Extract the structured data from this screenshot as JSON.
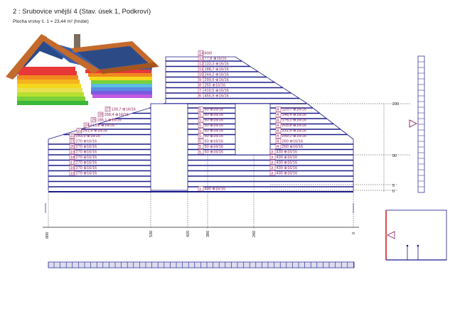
{
  "header": {
    "title": "2 : Srubovice vnější 4 (Stav. úsek 1, Podkroví)",
    "subtitle": "Plocha vrstvy č. 1 = 23,44 m² (hrubé)"
  },
  "colors": {
    "log_line": "#1a1a8c",
    "label_text": "#8a1a5a",
    "dimension_text": "#222222",
    "highlight_red": "#d23a3a"
  },
  "left_wall": {
    "labels": [
      {
        "n": "27",
        "t": "130,7 ⊕16/16"
      },
      {
        "n": "26",
        "t": "158,4 ⊕16/16"
      },
      {
        "n": "25",
        "t": "186,1 ⊕16/16"
      },
      {
        "n": "24",
        "t": "213,8 ⊕16/16"
      },
      {
        "n": "23",
        "t": "241,5 ⊕16/16"
      },
      {
        "n": "22",
        "t": "253,9 ⊕16/16"
      },
      {
        "n": "21",
        "t": "270 ⊕16/16"
      },
      {
        "n": "20",
        "t": "270 ⊕16/16"
      },
      {
        "n": "19",
        "t": "270 ⊕16/16"
      },
      {
        "n": "18",
        "t": "270 ⊕16/16"
      },
      {
        "n": "17",
        "t": "270 ⊕16/16"
      },
      {
        "n": "16",
        "t": "270 ⊕16/16"
      },
      {
        "n": "15",
        "t": "270 ⊕16/16"
      }
    ]
  },
  "center_upper": {
    "labels": [
      {
        "n": "14",
        "t": "60/0"
      },
      {
        "n": "13",
        "t": "77,8 ⊕16/16"
      },
      {
        "n": "12",
        "t": "133,3 ⊕16/16"
      },
      {
        "n": "11",
        "t": "188,7 ⊕16/16"
      },
      {
        "n": "10",
        "t": "244,2 ⊕16/16"
      },
      {
        "n": "9",
        "t": "299,6 ⊕16/16"
      },
      {
        "n": "8",
        "t": "355 ⊕16/16"
      },
      {
        "n": "7",
        "t": "410,5 ⊕16/16"
      },
      {
        "n": "6",
        "t": "465,9 ⊕16/16"
      }
    ]
  },
  "center_column": {
    "labels": [
      {
        "n": "5",
        "t": "50 ⊕16/16"
      },
      {
        "n": "5",
        "t": "50 ⊕16/16"
      },
      {
        "n": "5",
        "t": "50 ⊕16/16"
      },
      {
        "n": "5",
        "t": "50 ⊕16/16"
      },
      {
        "n": "5",
        "t": "50 ⊕16/16"
      },
      {
        "n": "5",
        "t": "50 ⊕16/16"
      },
      {
        "n": "5",
        "t": "50 ⊕16/16"
      },
      {
        "n": "5",
        "t": "50 ⊕16/16"
      },
      {
        "n": "5",
        "t": "50 ⊕16/16"
      }
    ],
    "bottom_label": {
      "n": "1",
      "t": "400 ⊕16/16"
    }
  },
  "right_wall": {
    "labels": [
      {
        "n": "4",
        "t": "120,7 ⊕16/16"
      },
      {
        "n": "4",
        "t": "148,4 ⊕16/16"
      },
      {
        "n": "4",
        "t": "176,1 ⊕16/16"
      },
      {
        "n": "4",
        "t": "203,8 ⊕16/16"
      },
      {
        "n": "4",
        "t": "231,5 ⊕16/16"
      },
      {
        "n": "4",
        "t": "259,2 ⊕16/16"
      },
      {
        "n": "4",
        "t": "260 ⊕16/16"
      },
      {
        "n": "4",
        "t": "260 ⊕16/16"
      },
      {
        "n": "3",
        "t": "430 ⊕16/16"
      },
      {
        "n": "3",
        "t": "430 ⊕16/16"
      },
      {
        "n": "3",
        "t": "430 ⊕16/16"
      },
      {
        "n": "3",
        "t": "430 ⊕16/16"
      },
      {
        "n": "3",
        "t": "430 ⊕16/16"
      }
    ]
  },
  "height_dimensions": {
    "top": "230",
    "middle": "90",
    "low": "5",
    "base": "0"
  },
  "width_dimensions": [
    "800",
    "530",
    "420",
    "380",
    "260",
    "0"
  ],
  "icons": {
    "house": "log-house-3d-icon",
    "level_marker": "level-triangle-icon"
  }
}
